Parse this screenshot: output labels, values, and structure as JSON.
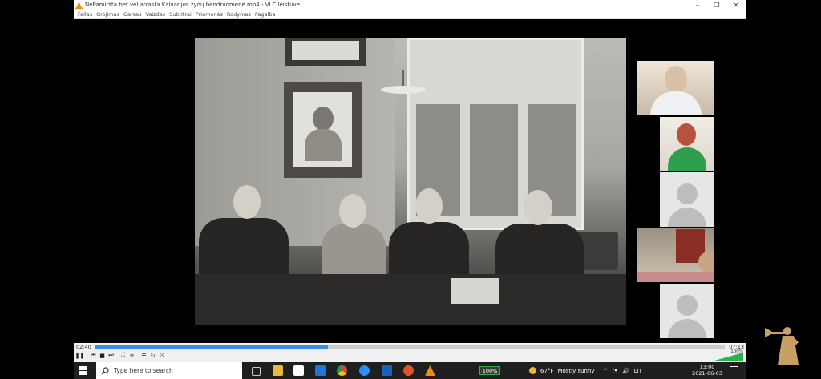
{
  "window": {
    "title": "NePamiršta bet vel atrasta Kalvarijos žydų bendruomenė.mp4 - VLC leistuve",
    "controls": [
      "–",
      "❐",
      "✕"
    ]
  },
  "menu": [
    "Failas",
    "Grojimas",
    "Garsas",
    "Vaizdas",
    "Subtitrai",
    "Priemonės",
    "Rodymas",
    "Pagalba"
  ],
  "player": {
    "time_elapsed": "02:40",
    "time_total": "07:13",
    "progress": 0.37,
    "volume_label": "100%",
    "volume": 1.0
  },
  "taskbar": {
    "search_placeholder": "Type here to search",
    "battery": "100%",
    "weather_temp": "67°F",
    "weather_text": "Mostly sunny",
    "lang": "LIT",
    "time": "13:00",
    "date": "2021-06-03"
  },
  "colors": {
    "seek": "#3a8ee6",
    "volume": "#2db34a",
    "taskbar": "#1f1f1f"
  }
}
